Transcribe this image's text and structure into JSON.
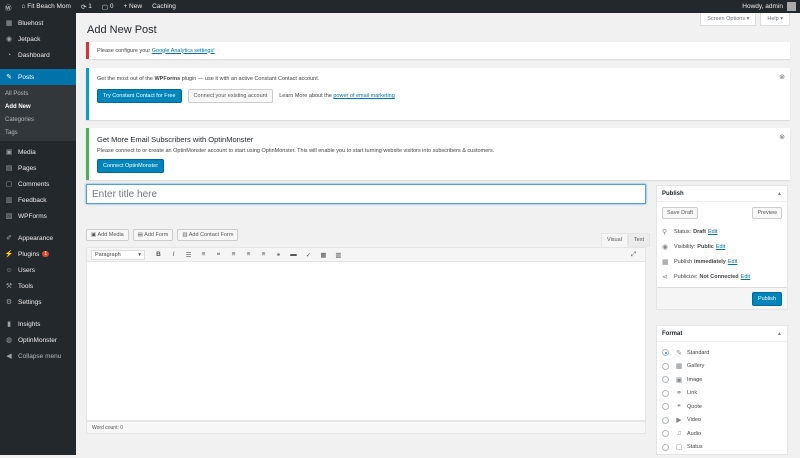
{
  "adminbar": {
    "wp_logo": "wordpress-icon",
    "site_name": "Fit Beach Mom",
    "updates_count": "1",
    "comments_count": "0",
    "new_label": "New",
    "caching_label": "Caching",
    "howdy": "Howdy, admin"
  },
  "sidebar": {
    "items": [
      {
        "label": "Bluehost",
        "icon": "bluehost-icon"
      },
      {
        "label": "Jetpack",
        "icon": "jetpack-icon"
      },
      {
        "label": "Dashboard",
        "icon": "dashboard-icon"
      },
      {
        "label": "Posts",
        "icon": "pin-icon"
      },
      {
        "label": "Media",
        "icon": "media-icon"
      },
      {
        "label": "Pages",
        "icon": "page-icon"
      },
      {
        "label": "Comments",
        "icon": "comment-icon"
      },
      {
        "label": "Feedback",
        "icon": "feedback-icon"
      },
      {
        "label": "WPForms",
        "icon": "forms-icon"
      },
      {
        "label": "Appearance",
        "icon": "brush-icon"
      },
      {
        "label": "Plugins",
        "icon": "plugin-icon",
        "badge": "1"
      },
      {
        "label": "Users",
        "icon": "users-icon"
      },
      {
        "label": "Tools",
        "icon": "wrench-icon"
      },
      {
        "label": "Settings",
        "icon": "settings-icon"
      },
      {
        "label": "Insights",
        "icon": "insights-icon"
      },
      {
        "label": "OptinMonster",
        "icon": "optinmonster-icon"
      },
      {
        "label": "Collapse menu",
        "icon": "collapse-icon"
      }
    ],
    "posts_sub": [
      "All Posts",
      "Add New",
      "Categories",
      "Tags"
    ]
  },
  "header": {
    "title": "Add New Post",
    "screen_options": "Screen Options ▾",
    "help": "Help ▾"
  },
  "notices": {
    "ga_text": "Please configure your",
    "ga_link": "Google Analytics settings!",
    "wpforms_pre": "Get the most out of the",
    "wpforms_bold": "WPForms",
    "wpforms_post": "plugin — use it with an active Constant Contact account.",
    "wpforms_btn1": "Try Constant Contact for Free",
    "wpforms_btn2": "Connect your existing account",
    "wpforms_learn": "Learn More about the",
    "wpforms_link": "power of email marketing",
    "om_title": "Get More Email Subscribers with OptinMonster",
    "om_text": "Please connect to or create an OptinMonster account to start using OptinMonster. This will enable you to start turning website visitors into subscribers & customers.",
    "om_btn": "Connect OptinMonster"
  },
  "editor": {
    "title_placeholder": "Enter title here",
    "add_media": "Add Media",
    "add_form": "Add Form",
    "add_contact_form": "Add Contact Form",
    "tab_visual": "Visual",
    "tab_text": "Text",
    "format_select": "Paragraph",
    "word_count": "Word count: 0"
  },
  "publish": {
    "title": "Publish",
    "save_draft": "Save Draft",
    "preview": "Preview",
    "status_label": "Status:",
    "status_value": "Draft",
    "visibility_label": "Visibility:",
    "visibility_value": "Public",
    "publish_label": "Publish",
    "publish_value": "immediately",
    "publicize_label": "Publicize:",
    "publicize_value": "Not Connected",
    "edit": "Edit",
    "publish_button": "Publish"
  },
  "format": {
    "title": "Format",
    "options": [
      {
        "label": "Standard",
        "icon": "pin-icon",
        "checked": true
      },
      {
        "label": "Gallery",
        "icon": "gallery-icon"
      },
      {
        "label": "Image",
        "icon": "image-icon"
      },
      {
        "label": "Link",
        "icon": "link-icon"
      },
      {
        "label": "Quote",
        "icon": "quote-icon"
      },
      {
        "label": "Video",
        "icon": "video-icon"
      },
      {
        "label": "Audio",
        "icon": "audio-icon"
      },
      {
        "label": "Status",
        "icon": "status-icon"
      }
    ]
  }
}
